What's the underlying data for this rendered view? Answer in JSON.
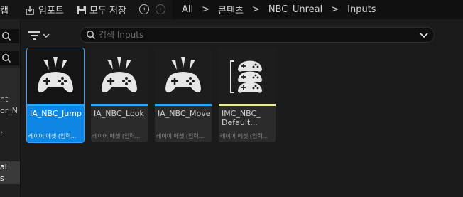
{
  "toolbar": {
    "partial_label": "캡",
    "import_label": "임포트",
    "saveall_label": "모두 저장"
  },
  "breadcrumb": [
    "All",
    "콘텐츠",
    "NBC_Unreal",
    "Inputs"
  ],
  "leftpanel": {
    "items": [
      "nt",
      "or_N",
      "al",
      "s"
    ]
  },
  "search": {
    "placeholder": "검색 Inputs"
  },
  "assets": [
    {
      "name": "IA_NBC_Jump",
      "type": "레이어 에셋 (입력...",
      "icon": "gamepad-icon",
      "bar_color": "#20aaff",
      "selected": true
    },
    {
      "name": "IA_NBC_Look",
      "type": "레이어 에셋 (입력...",
      "icon": "gamepad-icon",
      "bar_color": "#20aaff",
      "selected": false
    },
    {
      "name": "IA_NBC_Move",
      "type": "레이어 에셋 (입력...",
      "icon": "gamepad-icon",
      "bar_color": "#20aaff",
      "selected": false
    },
    {
      "name": "IMC_NBC_\nDefault...",
      "type": "레이어 에셋 (입력...",
      "icon": "mapping-context-icon",
      "bar_color": "#e8e8a0",
      "selected": false
    }
  ],
  "colors": {
    "accent": "#0e86e6",
    "input_action": "#20aaff",
    "mapping_context": "#e8e8a0"
  }
}
